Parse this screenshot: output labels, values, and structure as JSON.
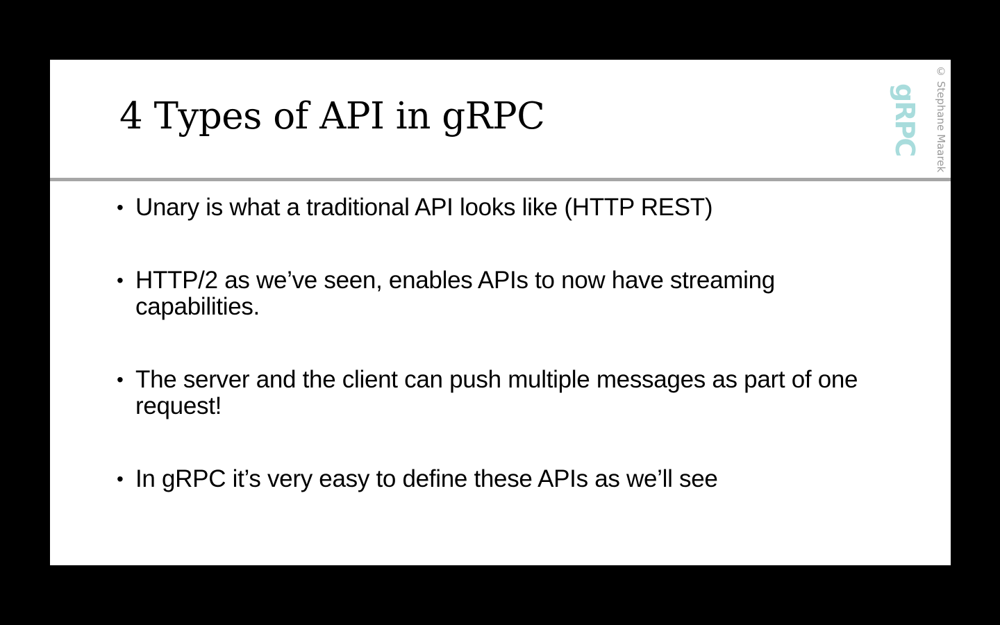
{
  "slide": {
    "title": "4 Types of API in gRPC",
    "bullets": [
      {
        "marker": "•",
        "text": "Unary is what a traditional API looks like (HTTP REST)"
      },
      {
        "marker": "•",
        "text": "HTTP/2 as we’ve seen, enables APIs to now have streaming capabilities."
      },
      {
        "marker": "•",
        "text": "The server and the client can push multiple messages as part of one request!"
      },
      {
        "marker": "•",
        "text": "In gRPC it’s very easy to define these APIs as we’ll see"
      }
    ],
    "watermark": "© Stephane Maarek",
    "logo_text": "gRPC"
  },
  "colors": {
    "background": "#000000",
    "slide_background": "#ffffff",
    "rule": "#a6a6a6",
    "logo": "#a8dcdc",
    "watermark": "#9a9a9a"
  }
}
